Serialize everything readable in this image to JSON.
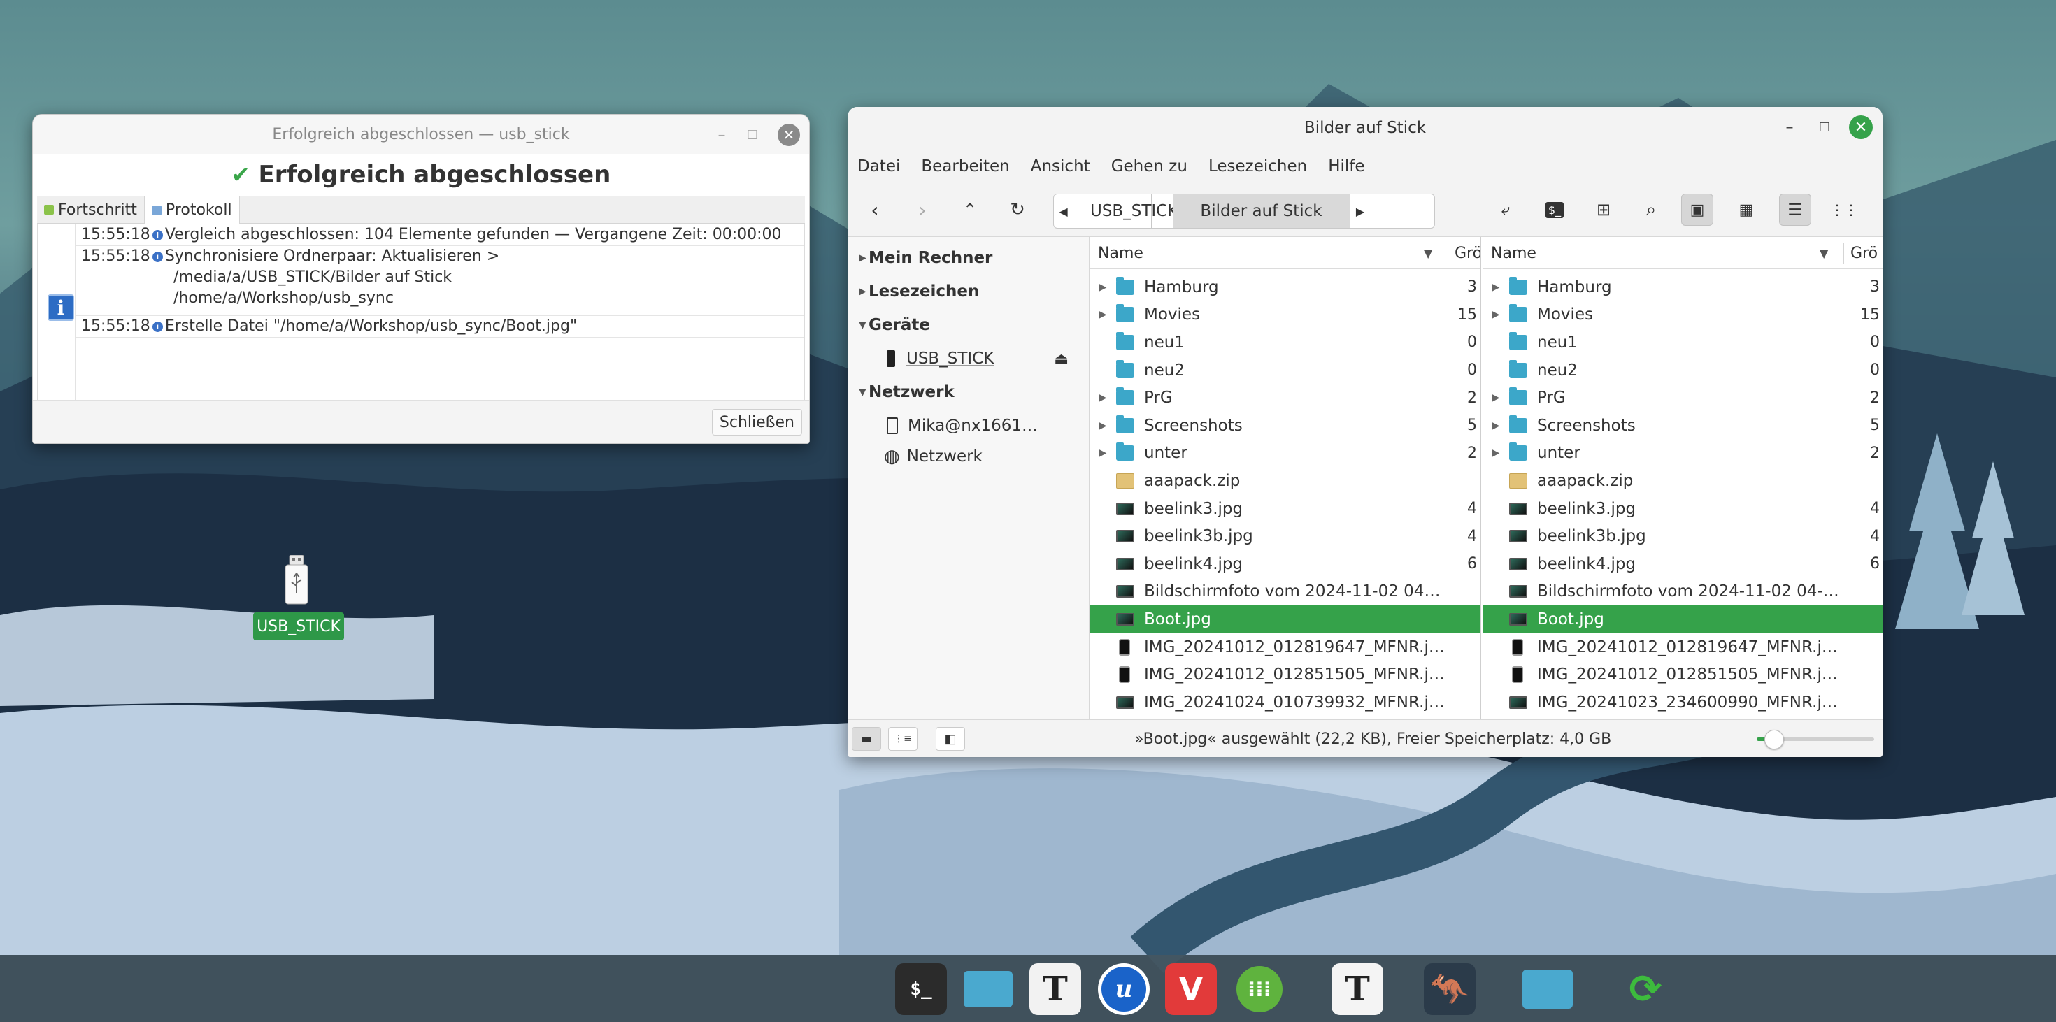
{
  "sync_window": {
    "title": "Erfolgreich abgeschlossen — usb_stick",
    "heading": "Erfolgreich abgeschlossen",
    "tabs": [
      "Fortschritt",
      "Protokoll"
    ],
    "log": [
      {
        "time": "15:55:18",
        "text": "Vergleich abgeschlossen: 104 Elemente gefunden — Vergangene Zeit: 00:00:00"
      },
      {
        "time": "15:55:18",
        "text": "Synchronisiere Ordnerpaar: Aktualisieren >",
        "extra": [
          "/media/a/USB_STICK/Bilder auf Stick",
          "/home/a/Workshop/usb_sync"
        ]
      },
      {
        "time": "15:55:18",
        "text": "Erstelle Datei \"/home/a/Workshop/usb_sync/Boot.jpg\""
      }
    ],
    "close_label": "Schließen"
  },
  "file_manager": {
    "title": "Bilder auf Stick",
    "menu": [
      "Datei",
      "Bearbeiten",
      "Ansicht",
      "Gehen zu",
      "Lesezeichen",
      "Hilfe"
    ],
    "breadcrumb": [
      "USB_STICK",
      "Bilder auf Stick"
    ],
    "sidebar": {
      "sections": [
        {
          "label": "Mein Rechner",
          "expanded": false
        },
        {
          "label": "Lesezeichen",
          "expanded": false
        },
        {
          "label": "Geräte",
          "expanded": true,
          "items": [
            "USB_STICK"
          ]
        },
        {
          "label": "Netzwerk",
          "expanded": true,
          "items": [
            "Mika@nx1661…",
            "Netzwerk"
          ]
        }
      ]
    },
    "columns": {
      "name": "Name",
      "size": "Grö"
    },
    "left_files": [
      {
        "name": "Hamburg",
        "type": "folder",
        "expandable": true,
        "size": "3"
      },
      {
        "name": "Movies",
        "type": "folder",
        "expandable": true,
        "size": "15"
      },
      {
        "name": "neu1",
        "type": "folder",
        "expandable": false,
        "size": "0"
      },
      {
        "name": "neu2",
        "type": "folder",
        "expandable": false,
        "size": "0"
      },
      {
        "name": "PrG",
        "type": "folder",
        "expandable": true,
        "size": "2"
      },
      {
        "name": "Screenshots",
        "type": "folder",
        "expandable": true,
        "size": "5"
      },
      {
        "name": "unter",
        "type": "folder",
        "expandable": true,
        "size": "2"
      },
      {
        "name": "aaapack.zip",
        "type": "zip",
        "size": ""
      },
      {
        "name": "beelink3.jpg",
        "type": "image",
        "size": "4"
      },
      {
        "name": "beelink3b.jpg",
        "type": "image",
        "size": "4"
      },
      {
        "name": "beelink4.jpg",
        "type": "image",
        "size": "6"
      },
      {
        "name": "Bildschirmfoto vom 2024-11-02 04-4…",
        "type": "image",
        "size": ""
      },
      {
        "name": "Boot.jpg",
        "type": "image",
        "size": "",
        "selected": true
      },
      {
        "name": "IMG_20241012_012819647_MFNR.j…",
        "type": "phone",
        "size": ""
      },
      {
        "name": "IMG_20241012_012851505_MFNR.j…",
        "type": "phone",
        "size": ""
      },
      {
        "name": "IMG_20241024_010739932_MFNR.j…",
        "type": "image",
        "size": ""
      }
    ],
    "right_files": [
      {
        "name": "Hamburg",
        "type": "folder",
        "expandable": true,
        "size": "3"
      },
      {
        "name": "Movies",
        "type": "folder",
        "expandable": true,
        "size": "15"
      },
      {
        "name": "neu1",
        "type": "folder",
        "expandable": false,
        "size": "0"
      },
      {
        "name": "neu2",
        "type": "folder",
        "expandable": false,
        "size": "0"
      },
      {
        "name": "PrG",
        "type": "folder",
        "expandable": true,
        "size": "2"
      },
      {
        "name": "Screenshots",
        "type": "folder",
        "expandable": true,
        "size": "5"
      },
      {
        "name": "unter",
        "type": "folder",
        "expandable": true,
        "size": "2"
      },
      {
        "name": "aaapack.zip",
        "type": "zip",
        "size": ""
      },
      {
        "name": "beelink3.jpg",
        "type": "image",
        "size": "4"
      },
      {
        "name": "beelink3b.jpg",
        "type": "image",
        "size": "4"
      },
      {
        "name": "beelink4.jpg",
        "type": "image",
        "size": "6"
      },
      {
        "name": "Bildschirmfoto vom 2024-11-02 04-4…",
        "type": "image",
        "size": ""
      },
      {
        "name": "Boot.jpg",
        "type": "image",
        "size": "",
        "selected": true
      },
      {
        "name": "IMG_20241012_012819647_MFNR.j…",
        "type": "phone",
        "size": ""
      },
      {
        "name": "IMG_20241012_012851505_MFNR.j…",
        "type": "phone",
        "size": ""
      },
      {
        "name": "IMG_20241023_234600990_MFNR.j…",
        "type": "image",
        "size": ""
      }
    ],
    "status_text": "»Boot.jpg« ausgewählt (22,2 KB), Freier Speicherplatz: 4,0 GB",
    "zoom_level": 0.1
  },
  "desktop": {
    "usb_label": "USB_STICK"
  },
  "taskbar": {
    "apps": [
      "terminal-icon",
      "files-icon",
      "text-editor-icon",
      "writer-icon",
      "vivaldi-icon",
      "calculator-icon",
      "typora-icon",
      "kangaroo-icon",
      "file-manager-icon",
      "sync-icon"
    ]
  },
  "colors": {
    "accent": "#35a24a",
    "folder": "#3ca7c9",
    "info_blue": "#2d6cc4"
  }
}
